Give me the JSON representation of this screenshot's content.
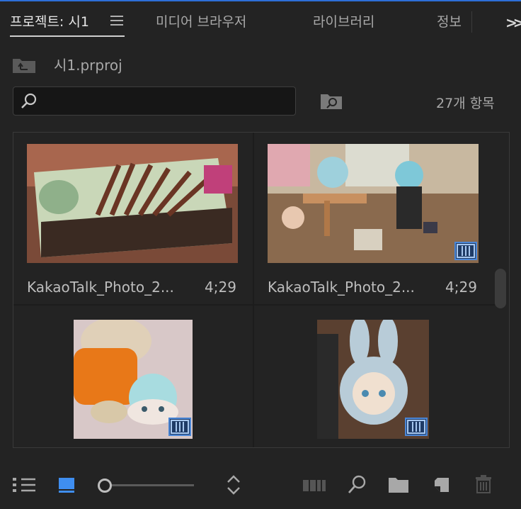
{
  "tabs": [
    {
      "label": "프로젝트: 시1",
      "active": true
    },
    {
      "label": "미디어 브라우저",
      "active": false
    },
    {
      "label": "라이브러리",
      "active": false
    },
    {
      "label": "정보",
      "active": false
    }
  ],
  "project": {
    "name": "시1.prproj"
  },
  "search": {
    "value": "",
    "placeholder": ""
  },
  "item_count": "27개 항목",
  "clips": [
    {
      "name": "KakaoTalk_Photo_2...",
      "duration": "4;29",
      "icon": "image-thumb",
      "badge": false
    },
    {
      "name": "KakaoTalk_Photo_2...",
      "duration": "4;29",
      "icon": "image-thumb",
      "badge": true
    },
    {
      "name": "",
      "duration": "",
      "icon": "image-thumb",
      "badge": true
    },
    {
      "name": "",
      "duration": "",
      "icon": "image-thumb",
      "badge": true
    }
  ],
  "zoom": {
    "level": 0.0
  },
  "toolbar": {
    "icons": [
      "list-view-icon",
      "icon-view-icon",
      "zoom-slider",
      "sort-icon",
      "automate-sequence-icon",
      "find-icon",
      "new-bin-icon",
      "new-item-icon",
      "delete-icon"
    ]
  },
  "colors": {
    "accent": "#2d6fd8",
    "panel": "#232323",
    "badge": "#4a86d6"
  }
}
